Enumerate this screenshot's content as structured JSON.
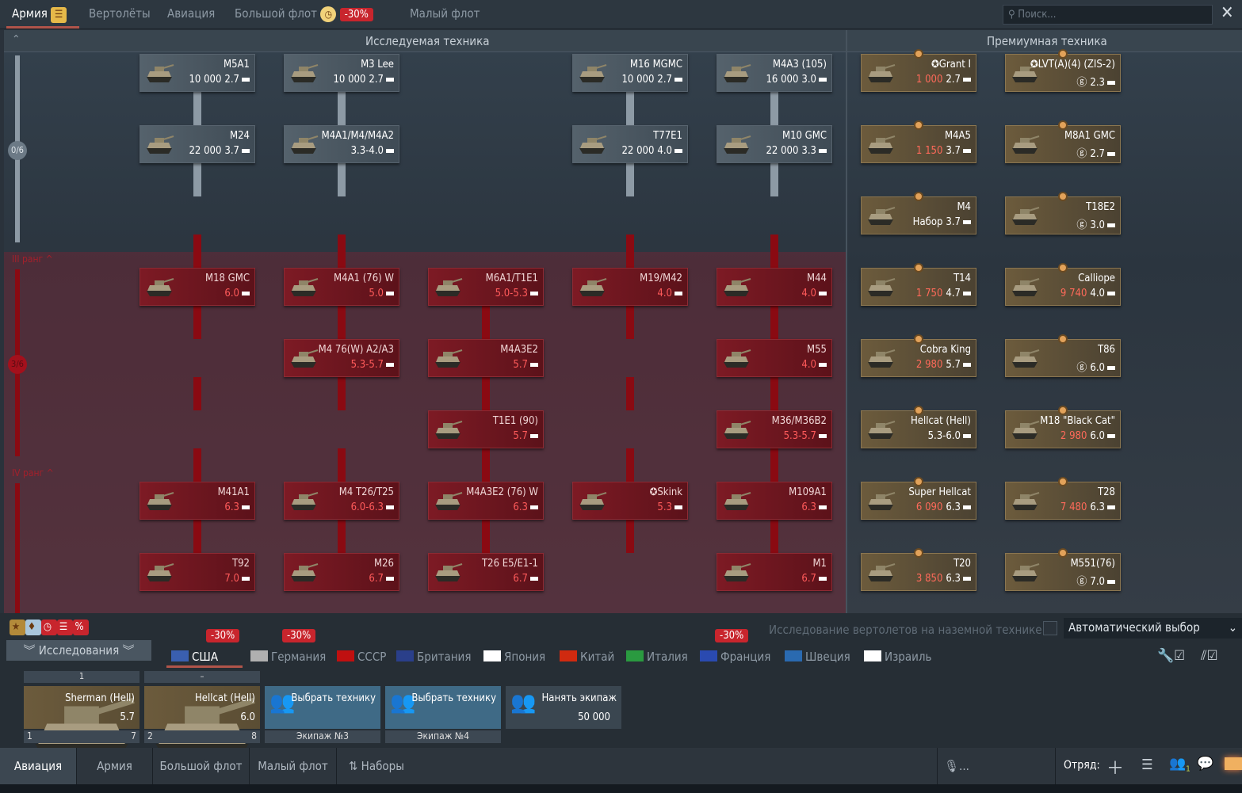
{
  "top_tabs": [
    "Армия",
    "Вертолёты",
    "Авиация",
    "Большой флот",
    "Малый флот"
  ],
  "top_discount": "-30%",
  "search_placeholder": "Поиск...",
  "headers": {
    "research": "Исследуемая техника",
    "premium": "Премиумная техника"
  },
  "ranks": {
    "progress_top": "0/6",
    "progress_mid": "3/6",
    "rank3": "III ранг ^",
    "rank4": "IV ранг ^"
  },
  "research_vehicles": [
    {
      "name": "M5A1",
      "cost": "10 000",
      "br": "2.7",
      "state": "done"
    },
    {
      "name": "M24",
      "cost": "22 000",
      "br": "3.7",
      "state": "done"
    },
    {
      "name": "M18 GMC",
      "br": "6.0",
      "state": "locked"
    },
    {
      "name": "M41A1",
      "br": "6.3",
      "state": "locked"
    },
    {
      "name": "T92",
      "br": "7.0",
      "state": "locked"
    },
    {
      "name": "M3 Lee",
      "cost": "10 000",
      "br": "2.7",
      "state": "done"
    },
    {
      "name": "M4A1/M4/M4A2",
      "br": "3.3-4.0",
      "state": "done"
    },
    {
      "name": "M4A1 (76) W",
      "br": "5.0",
      "state": "locked"
    },
    {
      "name": "M4 76(W) A2/A3",
      "br": "5.3-5.7",
      "state": "locked"
    },
    {
      "name": "M4 T26/T25",
      "br": "6.0-6.3",
      "state": "locked"
    },
    {
      "name": "M26",
      "br": "6.7",
      "state": "locked"
    },
    {
      "name": "M6A1/T1E1",
      "br": "5.0-5.3",
      "state": "locked"
    },
    {
      "name": "M4A3E2",
      "br": "5.7",
      "state": "locked"
    },
    {
      "name": "T1E1 (90)",
      "br": "5.7",
      "state": "locked"
    },
    {
      "name": "M4A3E2 (76) W",
      "br": "6.3",
      "state": "locked"
    },
    {
      "name": "T26 E5/E1-1",
      "br": "6.7",
      "state": "locked"
    },
    {
      "name": "M16 MGMC",
      "cost": "10 000",
      "br": "2.7",
      "state": "done"
    },
    {
      "name": "T77E1",
      "cost": "22 000",
      "br": "4.0",
      "state": "done"
    },
    {
      "name": "M19/M42",
      "br": "4.0",
      "state": "locked"
    },
    {
      "name": "✪Skink",
      "br": "5.3",
      "state": "locked"
    },
    {
      "name": "M4A3 (105)",
      "cost": "16 000",
      "br": "3.0",
      "state": "done"
    },
    {
      "name": "M10 GMC",
      "cost": "22 000",
      "br": "3.3",
      "state": "done"
    },
    {
      "name": "M44",
      "br": "4.0",
      "state": "locked"
    },
    {
      "name": "M55",
      "br": "4.0",
      "state": "locked"
    },
    {
      "name": "M36/M36B2",
      "br": "5.3-5.7",
      "state": "locked"
    },
    {
      "name": "M109A1",
      "br": "6.3",
      "state": "locked"
    },
    {
      "name": "M1",
      "br": "6.7",
      "state": "locked"
    }
  ],
  "premium_vehicles": [
    {
      "name": "✪Grant I",
      "cost": "1 000",
      "br": "2.7"
    },
    {
      "name": "M4A5",
      "cost": "1 150",
      "br": "3.7"
    },
    {
      "name": "M4",
      "cost": "Набор",
      "br": "3.7"
    },
    {
      "name": "T14",
      "cost": "1 750",
      "br": "4.7"
    },
    {
      "name": "Cobra King",
      "cost": "2 980",
      "br": "5.7"
    },
    {
      "name": "Hellcat (Hell)",
      "cost": "",
      "br": "5.3-6.0"
    },
    {
      "name": "Super Hellcat",
      "cost": "6 090",
      "br": "6.3"
    },
    {
      "name": "T20",
      "cost": "3 850",
      "br": "6.3"
    },
    {
      "name": "✪LVT(A)(4) (ZIS-2)",
      "cost": "ⓖ",
      "br": "2.3"
    },
    {
      "name": "M8A1 GMC",
      "cost": "ⓖ",
      "br": "2.7"
    },
    {
      "name": "T18E2",
      "cost": "ⓖ",
      "br": "3.0"
    },
    {
      "name": "Calliope",
      "cost": "9 740",
      "br": "4.0"
    },
    {
      "name": "T86",
      "cost": "ⓖ",
      "br": "6.0"
    },
    {
      "name": "M18 \"Black Cat\"",
      "cost": "2 980",
      "br": "6.0"
    },
    {
      "name": "T28",
      "cost": "7 480",
      "br": "6.3"
    },
    {
      "name": "M551(76)",
      "cost": "ⓖ",
      "br": "7.0"
    }
  ],
  "bottom": {
    "research_label": "Исследования",
    "discount": "-30%",
    "heli_option": "Исследование вертолетов на наземной технике",
    "auto_select": "Автоматический выбор",
    "nations": [
      "США",
      "Германия",
      "СССР",
      "Британия",
      "Япония",
      "Китай",
      "Италия",
      "Франция",
      "Швеция",
      "Израиль"
    ],
    "crew": [
      {
        "top": "1",
        "name": "Sherman (Hell)",
        "br": "5.7",
        "num": "1",
        "level": "7"
      },
      {
        "top": "–",
        "name": "Hellcat (Hell)",
        "br": "6.0",
        "num": "2",
        "level": "8"
      },
      {
        "name": "Выбрать технику",
        "label": "Экипаж №3"
      },
      {
        "name": "Выбрать технику",
        "label": "Экипаж №4"
      },
      {
        "name": "Нанять экипаж",
        "cost": "50 000"
      }
    ]
  },
  "nav": {
    "items": [
      "Авиация",
      "Армия",
      "Большой флот",
      "Малый флот",
      "Наборы"
    ],
    "voice": "...",
    "squad": "Отряд:",
    "friends_count": "1"
  }
}
